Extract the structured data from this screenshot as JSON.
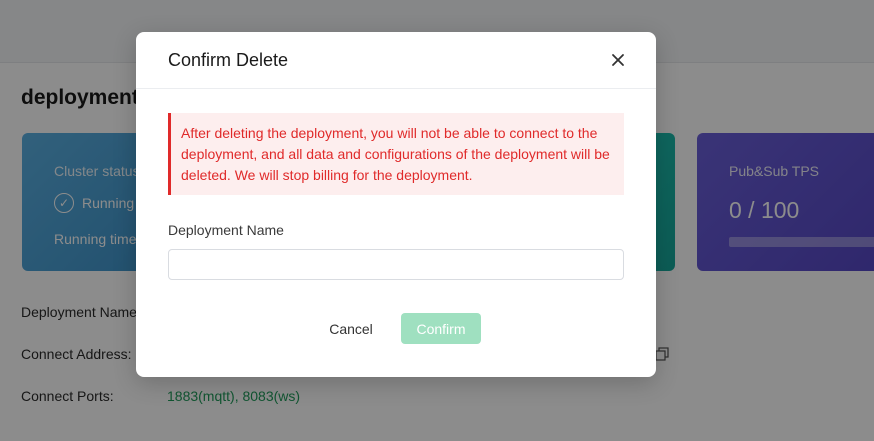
{
  "page": {
    "title": "deployment-",
    "cards": {
      "status": {
        "label": "Cluster status",
        "state": "Running",
        "running_time_label": "Running time"
      },
      "tps": {
        "label": "Pub&Sub TPS",
        "value": "0 / 100",
        "progress": 0
      }
    },
    "info": [
      {
        "label": "Deployment Name",
        "value": ""
      },
      {
        "label": "Connect Address:",
        "value": ""
      },
      {
        "label": "Connect Ports:",
        "value": "1883(mqtt), 8083(ws)"
      }
    ]
  },
  "modal": {
    "title": "Confirm Delete",
    "close_icon": "close-icon",
    "warning": "After deleting the deployment, you will not be able to connect to the deployment, and all data and configurations of the deployment will be deleted. We will stop billing for the deployment.",
    "field_label": "Deployment Name",
    "input_value": "",
    "input_placeholder": "",
    "cancel_label": "Cancel",
    "confirm_label": "Confirm"
  },
  "colors": {
    "danger": "#e02a2a",
    "danger_bg": "#fdeeee",
    "confirm_disabled": "#9fe0c0",
    "success_text": "#1f9b5a",
    "card_blue": "#4aa0d6",
    "card_teal": "#1bb8a9",
    "card_purple": "#5f53cf"
  }
}
